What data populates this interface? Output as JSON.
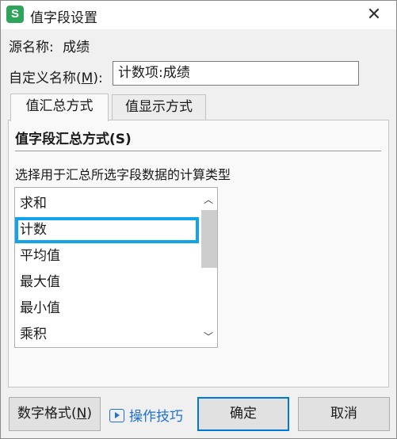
{
  "window": {
    "title": "值字段设置",
    "app_icon_letter": "S",
    "close_glyph": "✕"
  },
  "source": {
    "label": "源名称:",
    "value": "成绩"
  },
  "custom_name": {
    "label": "自定义名称(",
    "hotkey": "M",
    "label_end": "):",
    "value": "计数项:成绩"
  },
  "tabs": [
    {
      "label": "值汇总方式",
      "active": true
    },
    {
      "label": "值显示方式",
      "active": false
    }
  ],
  "summary": {
    "title": "值字段汇总方式(S)",
    "description": "选择用于汇总所选字段数据的计算类型",
    "items": [
      "求和",
      "计数",
      "平均值",
      "最大值",
      "最小值",
      "乘积"
    ],
    "selected": "计数"
  },
  "scroll": {
    "up_glyph": "︿",
    "down_glyph": "﹀"
  },
  "buttons": {
    "number_format_prefix": "数字格式(",
    "number_format_hotkey": "N",
    "number_format_suffix": ")",
    "tips": "操作技巧",
    "ok": "确定",
    "cancel": "取消"
  },
  "colors": {
    "app_icon": "#2ea55a",
    "selection_outline": "#12a4e8",
    "link": "#1e6fd9",
    "default_button_border": "#0078d7"
  }
}
